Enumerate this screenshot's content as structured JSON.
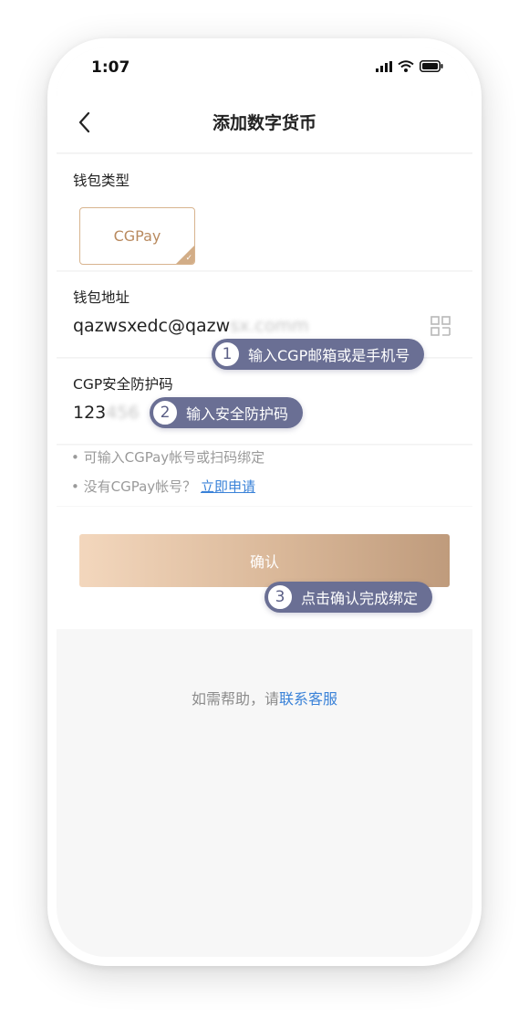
{
  "status_bar": {
    "time": "1:07"
  },
  "nav": {
    "title": "添加数字货币"
  },
  "wallet_type": {
    "label": "钱包类型",
    "option": "CGPay"
  },
  "wallet_address": {
    "label": "钱包地址",
    "value_visible": "qazwsxedc@qazw",
    "value_blurred": "sx.comm"
  },
  "security_code": {
    "label": "CGP安全防护码",
    "value_visible": "123",
    "value_blurred": "456"
  },
  "callouts": [
    {
      "num": "1",
      "text": "输入CGP邮箱或是手机号"
    },
    {
      "num": "2",
      "text": "输入安全防护码"
    },
    {
      "num": "3",
      "text": "点击确认完成绑定"
    }
  ],
  "tips": {
    "line1": "• 可输入CGPay帐号或扫码绑定",
    "line2_prefix": "• 没有CGPay帐号？",
    "line2_link": "立即申请"
  },
  "confirm_label": "确认",
  "help": {
    "prefix": "如需帮助，请",
    "link": "联系客服"
  },
  "colors": {
    "accent": "#d8b48f",
    "callout": "#6a6f94",
    "link": "#3a82d8"
  }
}
